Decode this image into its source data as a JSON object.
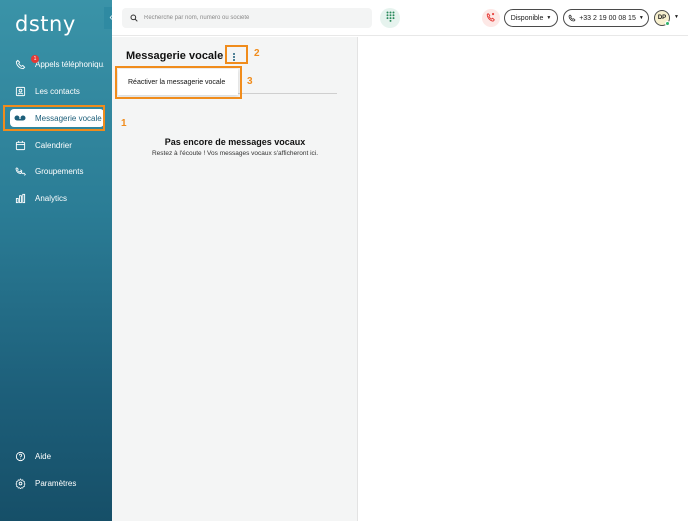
{
  "brand": {
    "logo": "dstny"
  },
  "sidebar": {
    "items": [
      {
        "label": "Appels téléphoniqu...",
        "icon": "phone-icon",
        "badge": "1"
      },
      {
        "label": "Les contacts",
        "icon": "contacts-icon"
      },
      {
        "label": "Messagerie vocale",
        "icon": "voicemail-icon",
        "active": true
      },
      {
        "label": "Calendrier",
        "icon": "calendar-icon"
      },
      {
        "label": "Groupements",
        "icon": "group-icon"
      },
      {
        "label": "Analytics",
        "icon": "bar-chart-icon"
      }
    ],
    "bottom": [
      {
        "label": "Aide",
        "icon": "help-icon"
      },
      {
        "label": "Paramètres",
        "icon": "gear-icon"
      }
    ]
  },
  "header": {
    "search_placeholder": "Recherche par nom, numéro ou société",
    "status_label": "Disponible",
    "phone_number": "+33 2 19 00 08 15",
    "avatar_initials": "DP"
  },
  "main": {
    "title": "Messagerie vocale",
    "menu_item": "Réactiver la messagerie vocale",
    "empty_title": "Pas encore de messages vocaux",
    "empty_subtitle": "Restez à l'écoute ! Vos messages vocaux s'afficheront ici."
  },
  "annotations": {
    "one": "1",
    "two": "2",
    "three": "3"
  },
  "colors": {
    "accent": "#1d5f7a",
    "highlight": "#f08c1c",
    "sidebar_top": "#3a93a8",
    "sidebar_bottom": "#164f68",
    "presence": "#2fb36b",
    "badge": "#e53935"
  }
}
